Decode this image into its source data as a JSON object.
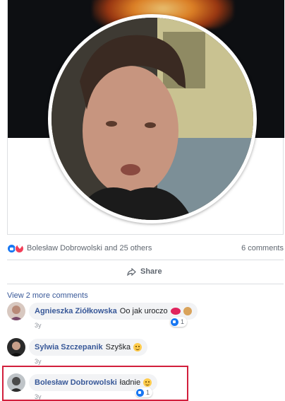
{
  "reactions": {
    "icons": [
      "like-icon",
      "love-icon"
    ],
    "summary": "Bolesław Dobrowolski and 25 others",
    "comment_count": "6 comments"
  },
  "actions": {
    "share_label": "Share"
  },
  "comments_section": {
    "view_more": "View 2 more comments",
    "comments": [
      {
        "author": "Agnieszka Ziółkowska",
        "text": "Oo jak uroczo",
        "emoji": [
          "kiss-mark-icon",
          "cookie-icon"
        ],
        "time": "3y",
        "likes": "1"
      },
      {
        "author": "Sylwia Szczepanik",
        "text": "Szyška",
        "emoji": [
          "smile-emoji-icon"
        ],
        "time": "3y"
      },
      {
        "author": "Bolesław Dobrowolski",
        "text": "ładnie",
        "emoji": [
          "smile-emoji-icon"
        ],
        "time": "3y",
        "likes": "1"
      }
    ]
  },
  "colors": {
    "link": "#385898",
    "highlight": "#d21f3c",
    "like": "#1877f2",
    "love": "#f33e58"
  }
}
